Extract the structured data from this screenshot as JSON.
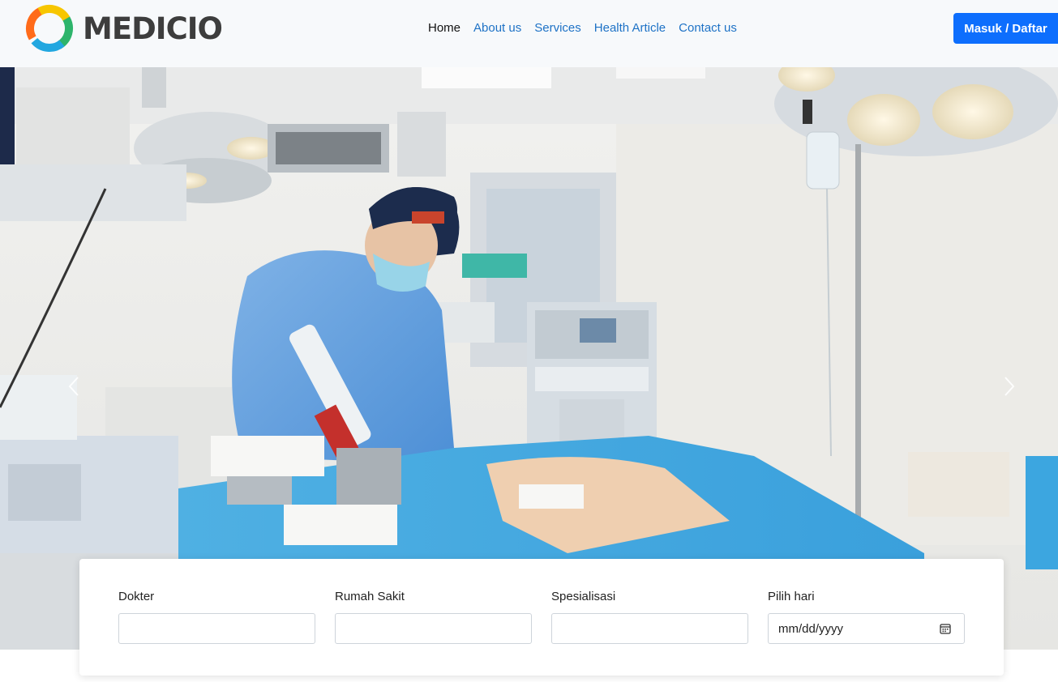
{
  "brand": {
    "name": "MEDICIO"
  },
  "nav": {
    "items": [
      {
        "label": "Home",
        "active": true
      },
      {
        "label": "About us",
        "active": false
      },
      {
        "label": "Services",
        "active": false
      },
      {
        "label": "Health Article",
        "active": false
      },
      {
        "label": "Contact us",
        "active": false
      }
    ],
    "login_label": "Masuk / Daftar"
  },
  "hero": {
    "image": "operating-room-surgeon-photo",
    "prev_icon": "chevron-left-icon",
    "next_icon": "chevron-right-icon"
  },
  "search": {
    "doctor_label": "Dokter",
    "doctor_value": "",
    "hospital_label": "Rumah Sakit",
    "hospital_value": "",
    "specialization_label": "Spesialisasi",
    "specialization_value": "",
    "day_label": "Pilih hari",
    "day_placeholder": "mm/dd/yyyy",
    "day_icon": "calendar-icon"
  },
  "colors": {
    "primary": "#0d6efd",
    "link": "#1e72c6",
    "navbar_bg": "#f7f9fb"
  }
}
